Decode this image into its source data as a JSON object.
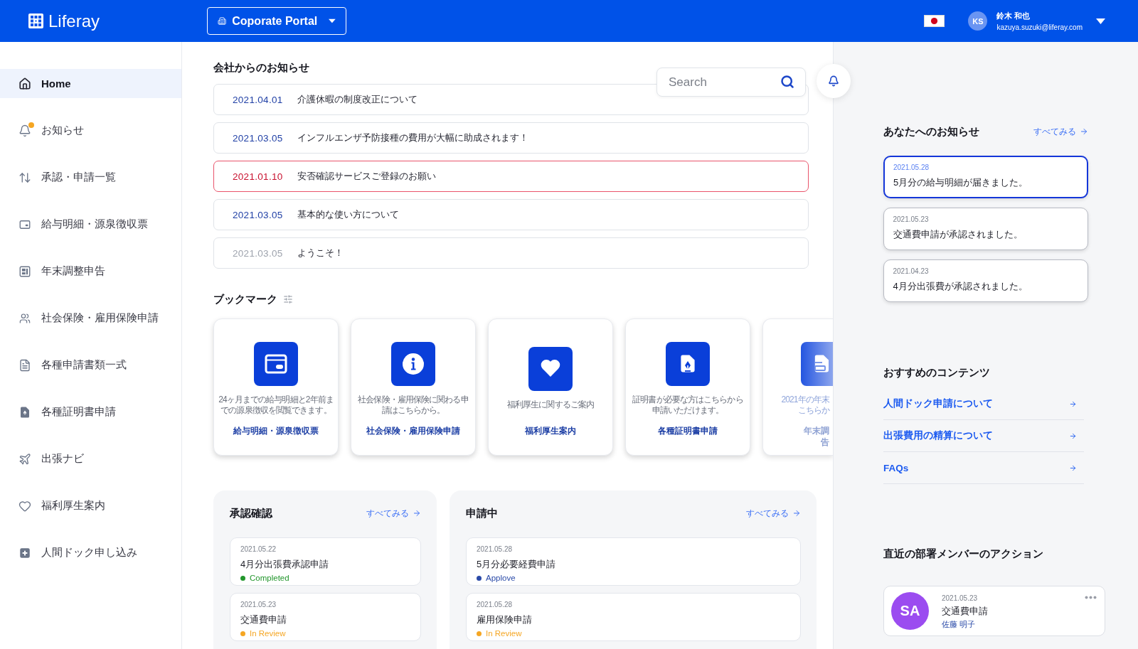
{
  "header": {
    "logo": "Liferay",
    "site": "Coporate Portal",
    "user": {
      "initials": "KS",
      "name": "鈴木 和也",
      "email": "kazuya.suzuki@liferay.com"
    }
  },
  "sidebar": {
    "items": [
      {
        "label": "Home",
        "selected": true,
        "alert": false
      },
      {
        "label": "お知らせ",
        "selected": false,
        "alert": true
      },
      {
        "label": "承認・申請一覧",
        "selected": false,
        "alert": false
      },
      {
        "label": "給与明細・源泉徴収票",
        "selected": false,
        "alert": false
      },
      {
        "label": "年末調整申告",
        "selected": false,
        "alert": false
      },
      {
        "label": "社会保険・雇用保険申請",
        "selected": false,
        "alert": false
      },
      {
        "label": "各種申請書類一式",
        "selected": false,
        "alert": false
      },
      {
        "label": "各種証明書申請",
        "selected": false,
        "alert": false
      },
      {
        "label": "出張ナビ",
        "selected": false,
        "alert": false
      },
      {
        "label": "福利厚生案内",
        "selected": false,
        "alert": false
      },
      {
        "label": "人間ドック申し込み",
        "selected": false,
        "alert": false
      }
    ]
  },
  "search": {
    "placeholder": "Search"
  },
  "company_notices": {
    "title": "会社からのお知らせ",
    "items": [
      {
        "date": "2021.04.01",
        "text": "介護休暇の制度改正について",
        "kind": "unread"
      },
      {
        "date": "2021.03.05",
        "text": "インフルエンザ予防接種の費用が大幅に助成されます！",
        "kind": "unread"
      },
      {
        "date": "2021.01.10",
        "text": "安否確認サービスご登録のお願い",
        "kind": "urgent"
      },
      {
        "date": "2021.03.05",
        "text": "基本的な使い方について",
        "kind": "unread"
      },
      {
        "date": "2021.03.05",
        "text": "ようこそ！",
        "kind": "read"
      }
    ]
  },
  "bookmarks": {
    "title": "ブックマーク",
    "cards": [
      {
        "kind": "full",
        "description_lines": [
          "24ヶ月までの給与明細と2年前ま",
          "での源泉徴収を閲覧できます。"
        ],
        "title_lines": [
          "給与明細・源泉徴収票"
        ]
      },
      {
        "kind": "full",
        "description_lines": [
          "社会保険・雇用保険に関わる申",
          "請はこちらから。"
        ],
        "title_lines": [
          "社会保険・雇用保険申請"
        ]
      },
      {
        "kind": "full",
        "description_lines": [
          "福利厚生に関するご案内"
        ],
        "title_lines": [
          "福利厚生案内"
        ]
      },
      {
        "kind": "full",
        "description_lines": [
          "証明書が必要な方はこちらから",
          "申請いただけます。"
        ],
        "title_lines": [
          "各種証明書申請"
        ]
      },
      {
        "kind": "partial",
        "description_lines": [
          "2021年の年末",
          "こちらか"
        ],
        "title_lines": [
          "年末調",
          "告"
        ]
      }
    ]
  },
  "approvals": {
    "title": "承認確認",
    "link": "すべてみる",
    "items": [
      {
        "date": "2021.05.22",
        "title": "4月分出張費承認申請",
        "status": "Completed",
        "color": "#22962c"
      },
      {
        "date": "2021.05.23",
        "title": "交通費申請",
        "status": "In Review",
        "color": "#f5a623"
      }
    ]
  },
  "in_progress": {
    "title": "申請中",
    "link": "すべてみる",
    "items": [
      {
        "date": "2021.05.28",
        "title": "5月分必要経費申請",
        "status": "Applove",
        "color": "#2a4aa8"
      },
      {
        "date": "2021.05.28",
        "title": "雇用保険申請",
        "status": "In Review",
        "color": "#f5a623"
      }
    ]
  },
  "your_notices": {
    "title": "あなたへのお知らせ",
    "link": "すべてみる",
    "items": [
      {
        "date": "2021.05.28",
        "text": "5月分の給与明細が届きました。",
        "selected": true
      },
      {
        "date": "2021.05.23",
        "text": "交通費申請が承認されました。",
        "selected": false
      },
      {
        "date": "2021.04.23",
        "text": "4月分出張費が承認されました。",
        "selected": false
      }
    ]
  },
  "recommended": {
    "title": "おすすめのコンテンツ",
    "links": [
      "人間ドック申請について",
      "出張費用の精算について",
      "FAQs"
    ]
  },
  "member_actions": {
    "title": "直近の部署メンバーのアクション",
    "items": [
      {
        "initials": "SA",
        "date": "2021.05.23",
        "title": "交通費申請",
        "name": "佐藤 明子",
        "color": "#9b4cf0"
      }
    ]
  }
}
